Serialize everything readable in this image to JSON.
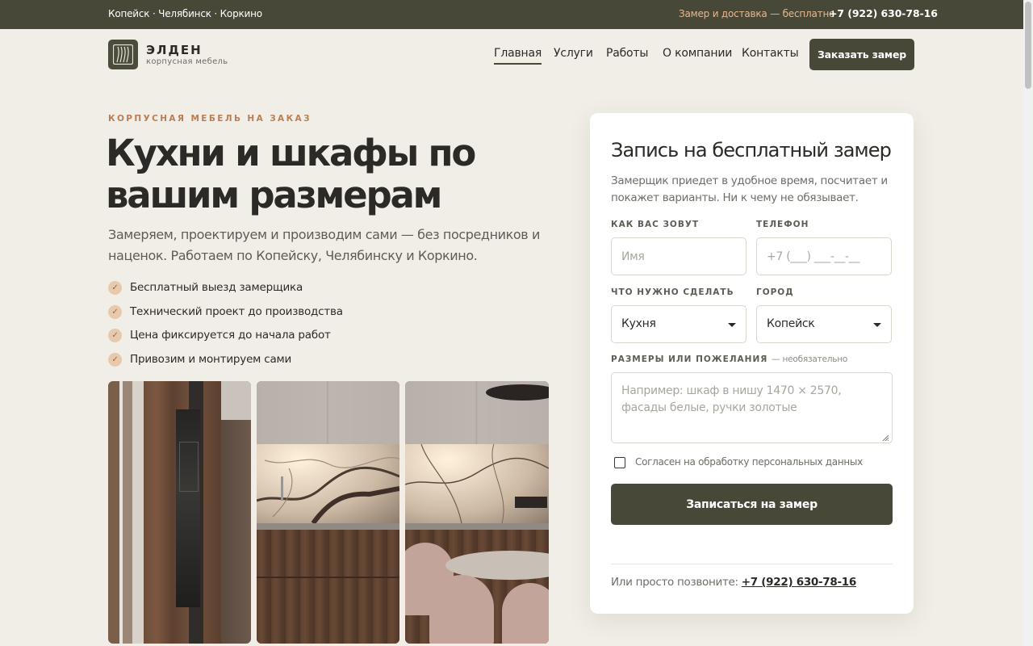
{
  "topbar": {
    "cities": "Копейск · Челябинск · Коркино",
    "promo": "Замер и доставка — бесплатно",
    "phone": "+7 (922) 630-78-16"
  },
  "brand": {
    "name": "ЭЛДЕН",
    "tagline": "корпусная мебель"
  },
  "nav": {
    "items": [
      {
        "label": "Главная",
        "active": true
      },
      {
        "label": "Услуги"
      },
      {
        "label": "Работы"
      },
      {
        "label": "О компании"
      },
      {
        "label": "Контакты"
      }
    ],
    "cta": "Заказать замер"
  },
  "hero": {
    "eyebrow": "КОРПУСНАЯ МЕБЕЛЬ НА ЗАКАЗ",
    "title": "Кухни и шкафы по вашим размерам",
    "lead": "Замеряем, проектируем и производим сами — без посредников и наценок. Работаем по Копейску, Челябинску и Коркино.",
    "bullets": [
      "Бесплатный выезд замерщика",
      "Технический проект до производства",
      "Цена фиксируется до начала работ",
      "Привозим и монтируем сами"
    ],
    "check_icon": "✓"
  },
  "form": {
    "title": "Запись на бесплатный замер",
    "subtitle": "Замерщик приедет в удобное время, посчитает и покажет варианты. Ни к чему не обязывает.",
    "name_label": "КАК ВАС ЗОВУТ",
    "name_placeholder": "Имя",
    "phone_label": "ТЕЛЕФОН",
    "phone_placeholder": "+7 (___) ___-__-__",
    "task_label": "ЧТО НУЖНО СДЕЛАТЬ",
    "task_value": "Кухня",
    "city_label": "ГОРОД",
    "city_value": "Копейск",
    "notes_label": "РАЗМЕРЫ ИЛИ ПОЖЕЛАНИЯ",
    "notes_optional": "— необязательно",
    "notes_placeholder": "Например: шкаф в нишу 1470 × 2570, фасады белые, ручки золотые",
    "consent": "Согласен на обработку персональных данных",
    "submit": "Записаться на замер",
    "call_text": "Или просто позвоните:",
    "call_phone": "+7 (922) 630-78-16"
  },
  "colors": {
    "accent": "#474838",
    "eyebrow": "#bb7e52",
    "promo": "#e4b890",
    "background": "#f1eee7"
  }
}
